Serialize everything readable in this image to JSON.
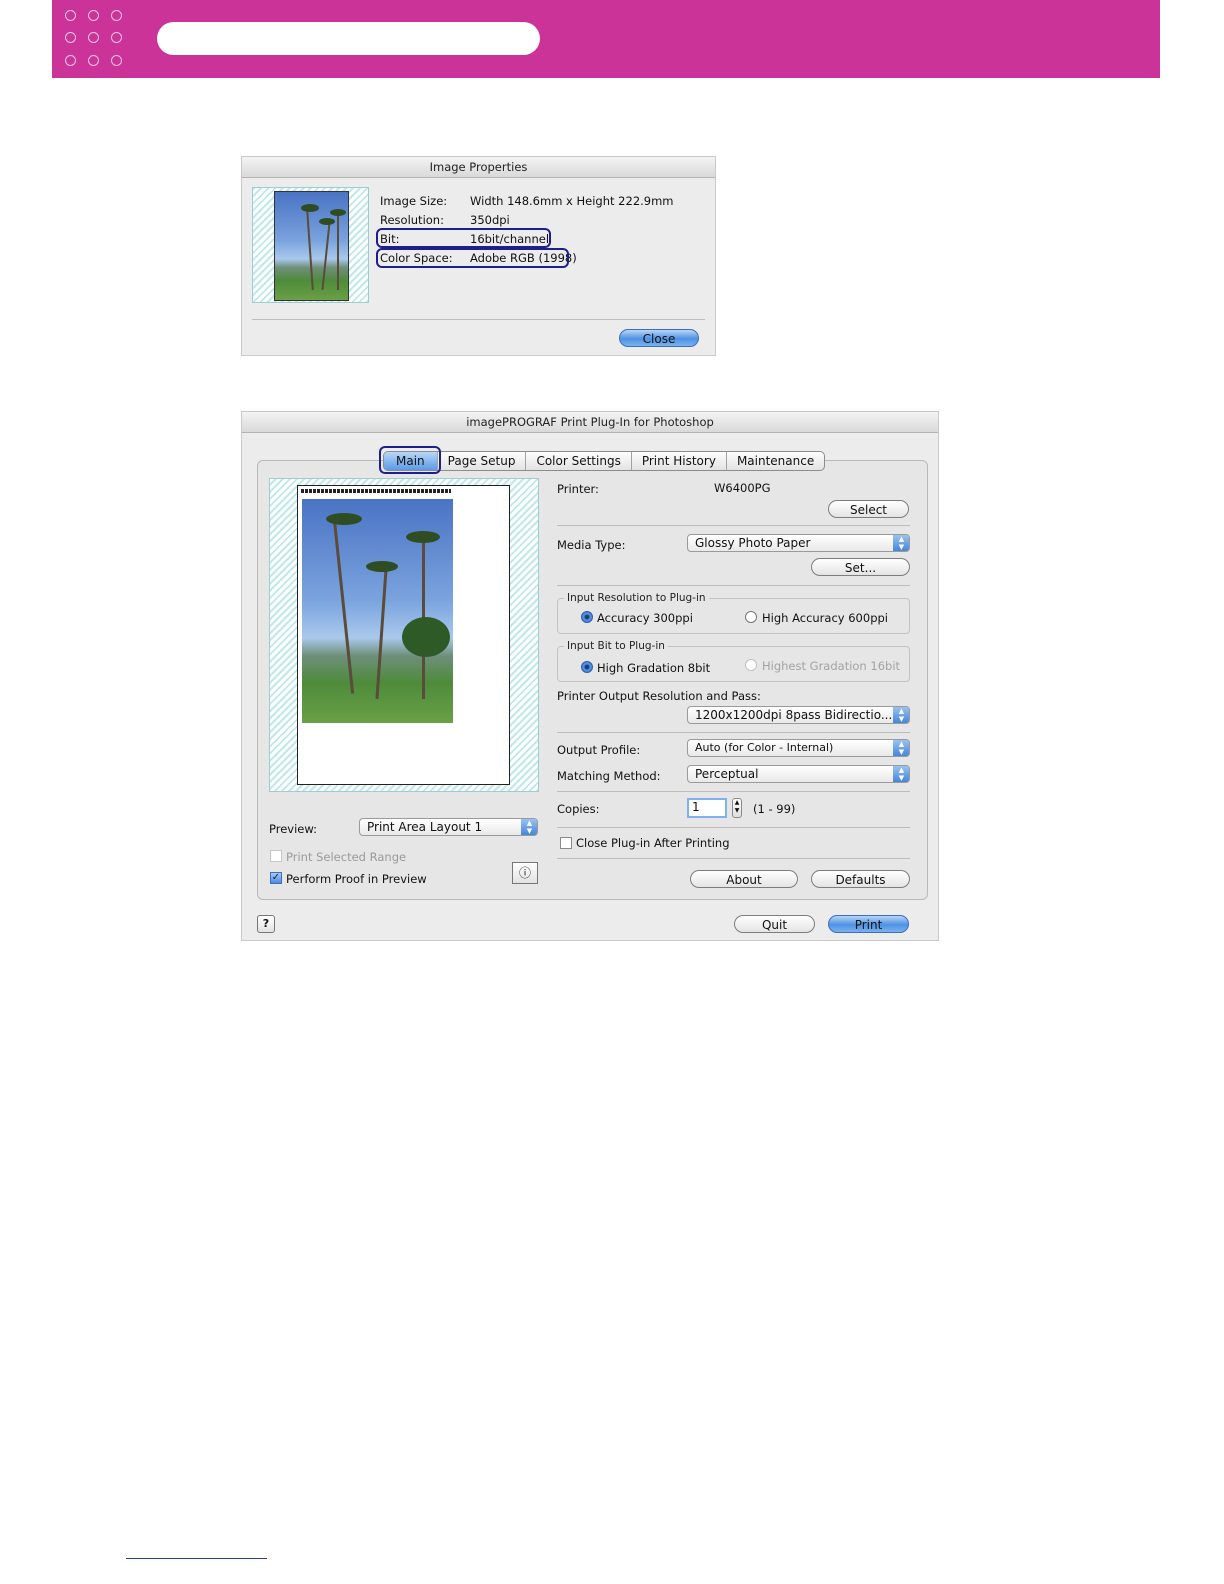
{
  "image_properties": {
    "title": "Image Properties",
    "rows": [
      {
        "label": "Image Size:",
        "value": "Width 148.6mm x Height 222.9mm"
      },
      {
        "label": "Resolution:",
        "value": "350dpi"
      },
      {
        "label": "Bit:",
        "value": "16bit/channel"
      },
      {
        "label": "Color Space:",
        "value": "Adobe RGB (1998)"
      }
    ],
    "close_label": "Close"
  },
  "plugin": {
    "title": "imagePROGRAF Print Plug-In for Photoshop",
    "tabs": [
      "Main",
      "Page Setup",
      "Color Settings",
      "Print History",
      "Maintenance"
    ],
    "printer_label": "Printer:",
    "printer_value": "W6400PG",
    "select_label": "Select",
    "media_type_label": "Media Type:",
    "media_type_value": "Glossy Photo Paper",
    "set_label": "Set...",
    "input_resolution": {
      "caption": "Input Resolution to Plug-in",
      "options": [
        "Accuracy 300ppi",
        "High Accuracy 600ppi"
      ],
      "selected": "Accuracy 300ppi"
    },
    "input_bit": {
      "caption": "Input Bit to Plug-in",
      "options": [
        "High Gradation 8bit",
        "Highest Gradation 16bit"
      ],
      "selected": "High Gradation 8bit"
    },
    "output_res_label": "Printer Output Resolution and Pass:",
    "output_res_value": "1200x1200dpi 8pass Bidirectio...",
    "output_profile_label": "Output Profile:",
    "output_profile_value": "Auto (for Color - Internal)",
    "matching_method_label": "Matching Method:",
    "matching_method_value": "Perceptual",
    "copies_label": "Copies:",
    "copies_value": "1",
    "copies_range": "(1 - 99)",
    "close_after_label": "Close Plug-in After Printing",
    "about_label": "About",
    "defaults_label": "Defaults",
    "preview_label": "Preview:",
    "preview_value": "Print Area Layout 1",
    "print_selected_label": "Print Selected Range",
    "perform_proof_label": "Perform Proof in Preview",
    "quit_label": "Quit",
    "print_label": "Print",
    "help_glyph": "?"
  },
  "accent": {
    "banner": "#cc3399",
    "highlight_ring": "#1d1f8f",
    "aqua": "#4f92e3"
  }
}
